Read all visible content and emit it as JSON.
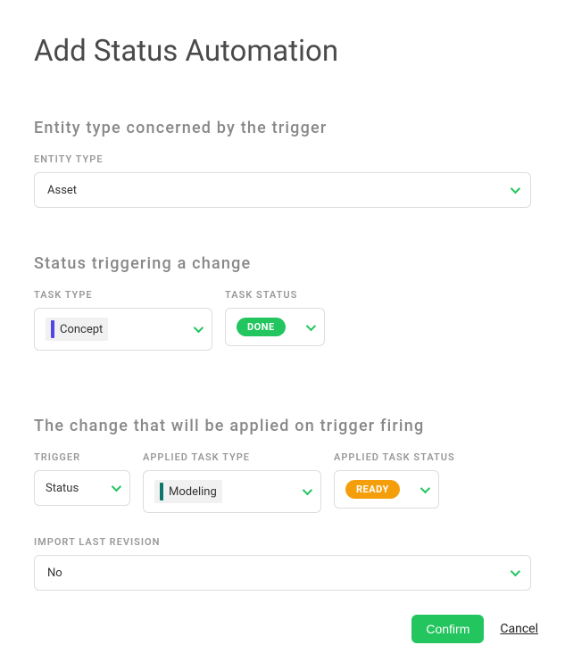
{
  "title": "Add Status Automation",
  "section_entity": {
    "heading": "Entity type concerned by the trigger",
    "entity_type_label": "ENTITY TYPE",
    "entity_type_value": "Asset"
  },
  "section_trigger": {
    "heading": "Status triggering a change",
    "task_type_label": "TASK TYPE",
    "task_type_value": "Concept",
    "task_type_color": "#4f46e5",
    "task_status_label": "TASK STATUS",
    "task_status_value": "DONE",
    "task_status_color": "#22c55e"
  },
  "section_change": {
    "heading": "The change that will be applied on trigger firing",
    "trigger_label": "TRIGGER",
    "trigger_value": "Status",
    "applied_task_type_label": "APPLIED TASK TYPE",
    "applied_task_type_value": "Modeling",
    "applied_task_type_color": "#0f766e",
    "applied_task_status_label": "APPLIED TASK STATUS",
    "applied_task_status_value": "READY",
    "applied_task_status_color": "#f59e0b",
    "import_last_revision_label": "IMPORT LAST REVISION",
    "import_last_revision_value": "No"
  },
  "footer": {
    "confirm": "Confirm",
    "cancel": "Cancel"
  }
}
